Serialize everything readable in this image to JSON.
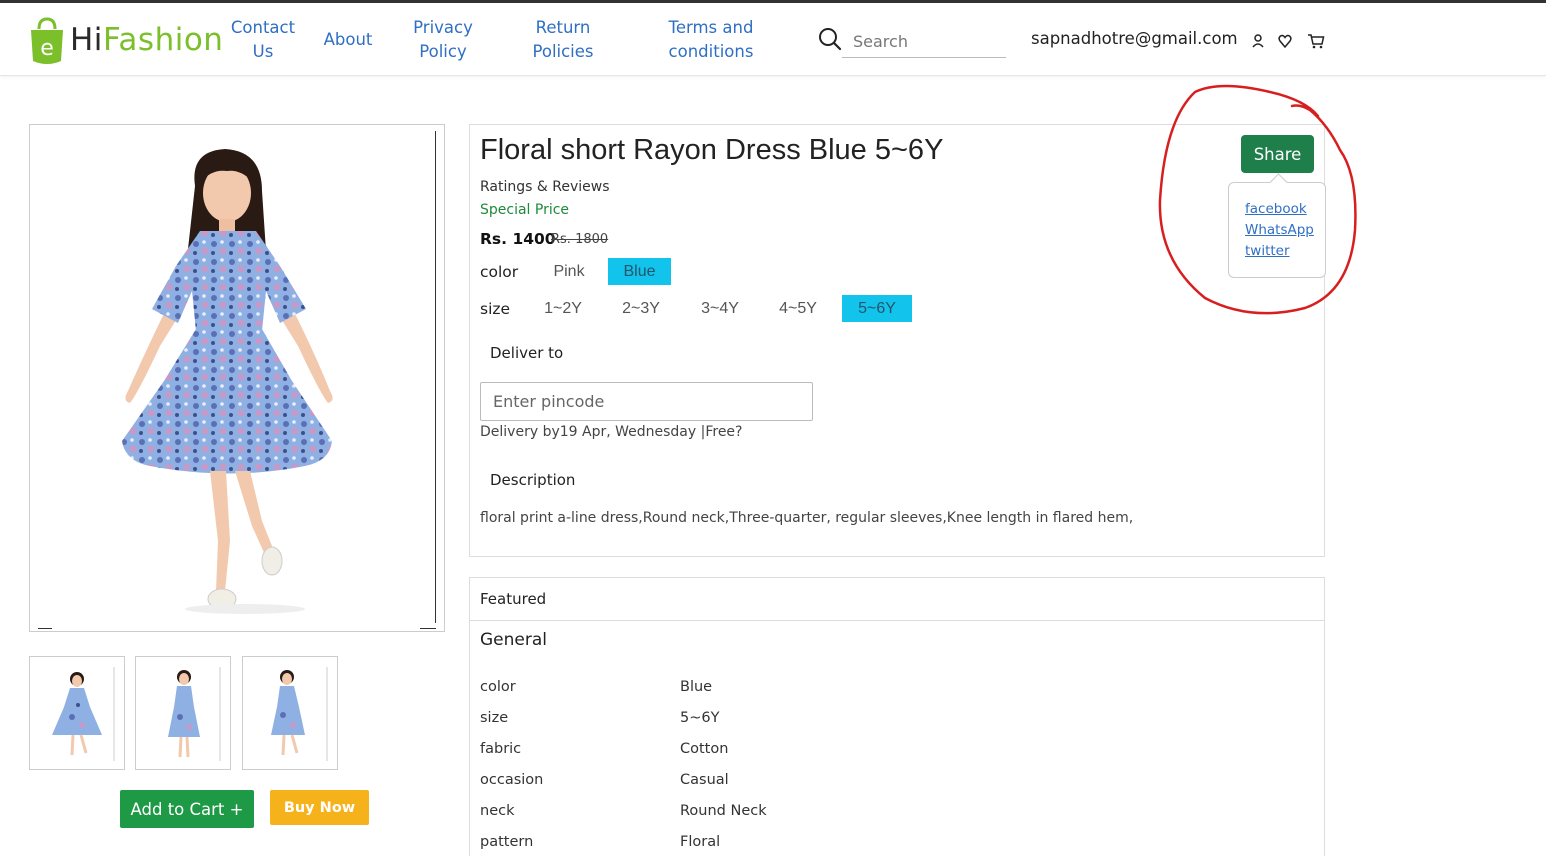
{
  "header": {
    "logo_letter": "e",
    "logo_part1": "Hi",
    "logo_part2": "Fashion",
    "nav": {
      "contact_1": "Contact",
      "contact_2": "Us",
      "about": "About",
      "privacy_1": "Privacy",
      "privacy_2": "Policy",
      "return_1": "Return",
      "return_2": "Policies",
      "terms_1": "Terms and",
      "terms_2": "conditions"
    },
    "search_placeholder": "Search",
    "user_email": "sapnadhotre@gmail.com",
    "icons": [
      "user-icon",
      "heart-icon",
      "cart-icon"
    ]
  },
  "product": {
    "title": "Floral short Rayon Dress Blue 5~6Y",
    "ratings_label": "Ratings & Reviews",
    "special_price_label": "Special Price",
    "price": "Rs. 1400",
    "old_price": "Rs. 1800",
    "color_label": "color",
    "colors": [
      "Pink",
      "Blue"
    ],
    "selected_color": "Blue",
    "size_label": "size",
    "sizes": [
      "1~2Y",
      "2~3Y",
      "3~4Y",
      "4~5Y",
      "5~6Y"
    ],
    "selected_size": "5~6Y",
    "deliver_label": "Deliver to",
    "pincode_placeholder": "Enter pincode",
    "delivery_text": "Delivery by19 Apr, Wednesday |Free?",
    "description_label": "Description",
    "description": "floral print a-line dress,Round neck,Three-quarter, regular sleeves,Knee length in flared hem,"
  },
  "share": {
    "button_label": "Share",
    "links": [
      "facebook",
      "WhatsApp",
      "twitter"
    ]
  },
  "actions": {
    "add_to_cart": "Add to Cart +",
    "buy_now": "Buy Now"
  },
  "featured": {
    "title": "Featured",
    "section": "General",
    "specs": [
      {
        "key": "color",
        "value": "Blue"
      },
      {
        "key": "size",
        "value": "5~6Y"
      },
      {
        "key": "fabric",
        "value": "Cotton"
      },
      {
        "key": "occasion",
        "value": "Casual"
      },
      {
        "key": "neck",
        "value": "Round Neck"
      },
      {
        "key": "pattern",
        "value": "Floral"
      }
    ]
  },
  "colors": {
    "link_blue": "#2f6fc4",
    "green_button": "#1e9a47",
    "share_green": "#1f7f4a",
    "buy_yellow": "#f5b21b",
    "selected_cyan": "#12c3ec",
    "annotation_red": "#d81f1f",
    "logo_green": "#7bbf2a"
  }
}
